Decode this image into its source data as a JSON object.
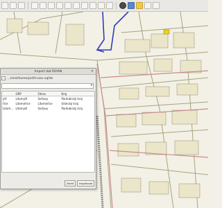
{
  "dialog": {
    "title": "Import dat RÚIAN",
    "close_glyph": "✕",
    "path_label": "…/mnt/home/pctf/ruian.sqlite",
    "table": {
      "columns": [
        "",
        "ORP",
        "Okres",
        "Kraj"
      ],
      "rows": [
        [
          "yšl",
          "Litomyšl",
          "Svitavy",
          "Pardubický kraj"
        ],
        [
          "říce",
          "Litomeřice",
          "Litomeřice",
          "Ústecký kraj"
        ],
        [
          "Litom…",
          "Litomyšl",
          "Svitavy",
          "Pardubický kraj"
        ]
      ]
    },
    "buttons": {
      "close": "Zavřít",
      "import": "Importovat"
    }
  },
  "colors": {
    "roads": "#a7a27f",
    "blue_line": "#2a3bbd",
    "pink_road": "#c98b8b"
  },
  "icons": [
    "zoom-in-icon",
    "zoom-out-icon",
    "pan-icon",
    "layer-icon",
    "identify-icon",
    "globe-icon"
  ]
}
